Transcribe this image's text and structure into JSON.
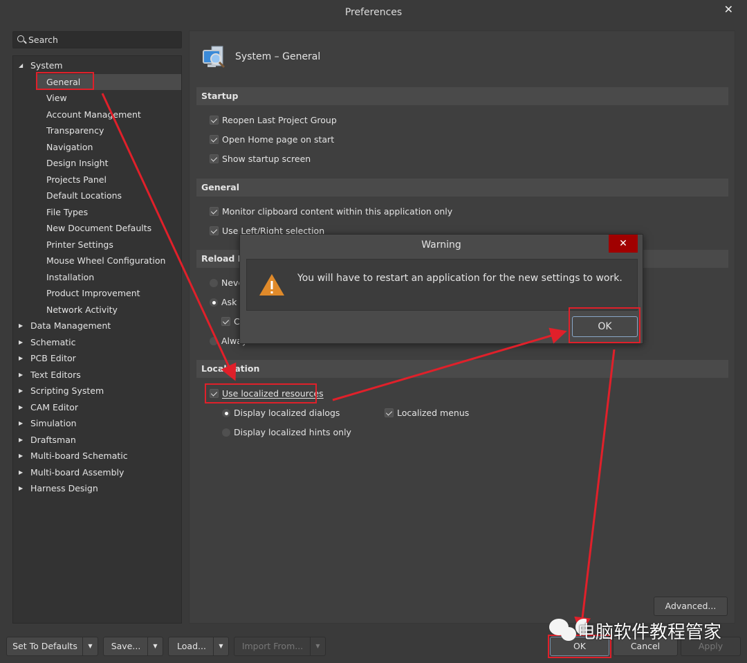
{
  "window": {
    "title": "Preferences",
    "close": "✕"
  },
  "search": {
    "placeholder": "Search"
  },
  "tree": {
    "root": "System",
    "children": [
      "General",
      "View",
      "Account Management",
      "Transparency",
      "Navigation",
      "Design Insight",
      "Projects Panel",
      "Default Locations",
      "File Types",
      "New Document Defaults",
      "Printer Settings",
      "Mouse Wheel Configuration",
      "Installation",
      "Product Improvement",
      "Network Activity"
    ],
    "selected": "General",
    "others": [
      "Data Management",
      "Schematic",
      "PCB Editor",
      "Text Editors",
      "Scripting System",
      "CAM Editor",
      "Simulation",
      "Draftsman",
      "Multi-board Schematic",
      "Multi-board Assembly",
      "Harness Design"
    ]
  },
  "page": {
    "title": "System – General",
    "startup": {
      "header": "Startup",
      "items": [
        {
          "label": "Reopen Last Project Group",
          "checked": true
        },
        {
          "label": "Open Home page on start",
          "checked": true
        },
        {
          "label": "Show startup screen",
          "checked": true
        }
      ]
    },
    "general": {
      "header": "General",
      "items": [
        {
          "label": "Monitor clipboard content within this application only",
          "checked": true
        },
        {
          "label": "Use Left/Right selection",
          "checked": true
        }
      ]
    },
    "reload": {
      "header": "Reload D",
      "never": "Neve",
      "ask": "Ask U",
      "sub": "C",
      "always": "Always"
    },
    "localization": {
      "header": "Localization",
      "use": "Use localized resources",
      "use_checked": true,
      "dialogs": "Display localized dialogs",
      "hints": "Display localized hints only",
      "menus": "Localized menus",
      "menus_checked": true
    },
    "advanced": "Advanced..."
  },
  "footer": {
    "set_defaults": "Set To Defaults",
    "save": "Save...",
    "load": "Load...",
    "import": "Import From...",
    "ok": "OK",
    "cancel": "Cancel",
    "apply": "Apply"
  },
  "dialog": {
    "title": "Warning",
    "close": "✕",
    "message": "You will have to restart an application for the new settings to work.",
    "ok": "OK",
    "icon": "warning-icon"
  },
  "watermark": "电脑软件教程管家",
  "colors": {
    "annotation": "#e0202a",
    "warning": "#e08a2a",
    "close_red": "#a00000"
  }
}
